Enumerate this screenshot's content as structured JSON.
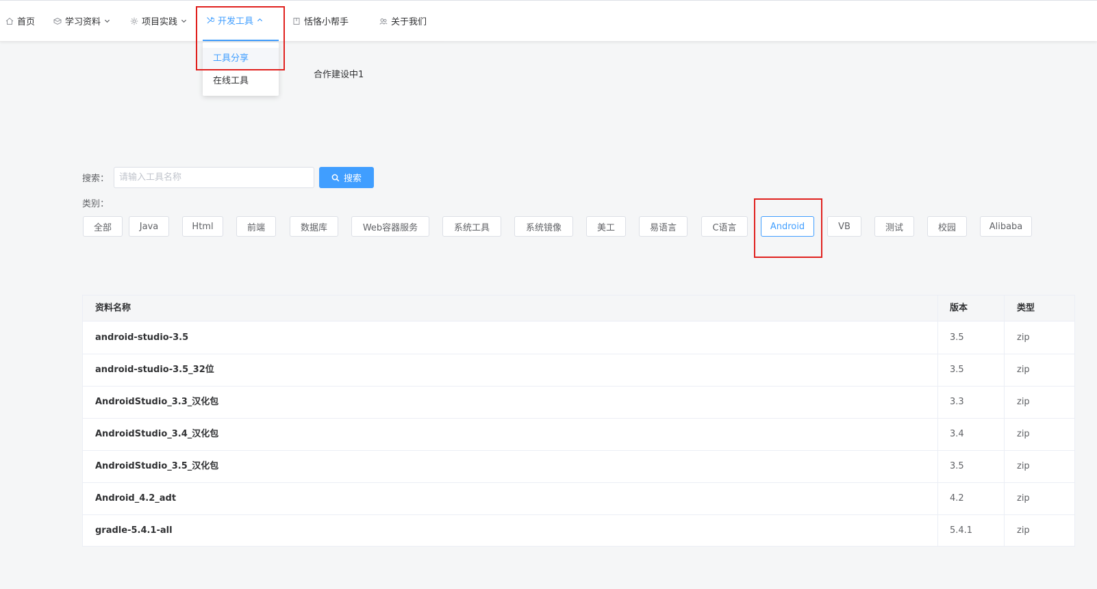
{
  "nav": {
    "items": [
      {
        "label": "首页",
        "icon": "home-icon"
      },
      {
        "label": "学习资料",
        "icon": "box-icon"
      },
      {
        "label": "项目实践",
        "icon": "gear-icon"
      },
      {
        "label": "开发工具",
        "icon": "tools-icon"
      },
      {
        "label": "恬恪小帮手",
        "icon": "document-icon"
      },
      {
        "label": "关于我们",
        "icon": "people-icon"
      }
    ],
    "dropdown": [
      "工具分享",
      "在线工具"
    ],
    "accent_color": "#409eff"
  },
  "main": {
    "construction_text": "合作建设中1",
    "search": {
      "label": "搜索：",
      "placeholder": "请输入工具名称",
      "value": "",
      "button_label": "搜索"
    },
    "category": {
      "label": "类别：",
      "items": [
        "全部",
        "Java",
        "Html",
        "前端",
        "数据库",
        "Web容器服务",
        "系统工具",
        "系统镜像",
        "美工",
        "易语言",
        "C语言",
        "Android",
        "VB",
        "测试",
        "校园",
        "Alibaba"
      ],
      "selected": "Android"
    },
    "table": {
      "headers": [
        "资料名称",
        "版本",
        "类型"
      ],
      "rows": [
        {
          "name": "android-studio-3.5",
          "version": "3.5",
          "type": "zip"
        },
        {
          "name": "android-studio-3.5_32位",
          "version": "3.5",
          "type": "zip"
        },
        {
          "name": "AndroidStudio_3.3_汉化包",
          "version": "3.3",
          "type": "zip"
        },
        {
          "name": "AndroidStudio_3.4_汉化包",
          "version": "3.4",
          "type": "zip"
        },
        {
          "name": "AndroidStudio_3.5_汉化包",
          "version": "3.5",
          "type": "zip"
        },
        {
          "name": "Android_4.2_adt",
          "version": "4.2",
          "type": "zip"
        },
        {
          "name": "gradle-5.4.1-all",
          "version": "5.4.1",
          "type": "zip"
        }
      ]
    }
  }
}
